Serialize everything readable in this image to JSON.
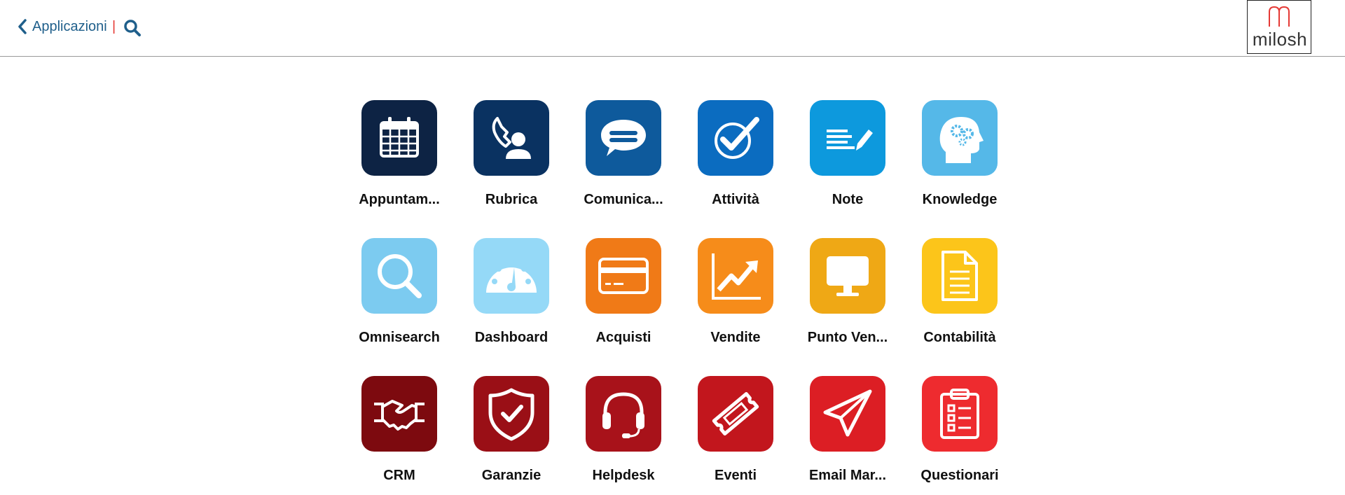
{
  "header": {
    "back_label": "Applicazioni",
    "separator": "|",
    "logo_text": "milosh"
  },
  "colors": {
    "primary": "#1f5f8b",
    "accent": "#e53935"
  },
  "apps": [
    {
      "label": "Appuntam...",
      "icon": "calendar-icon",
      "color": "#0d2344"
    },
    {
      "label": "Rubrica",
      "icon": "contact-phone-icon",
      "color": "#0a3261"
    },
    {
      "label": "Comunica...",
      "icon": "chat-bubble-icon",
      "color": "#0e5a9c"
    },
    {
      "label": "Attività",
      "icon": "check-circle-icon",
      "color": "#0b6cc0"
    },
    {
      "label": "Note",
      "icon": "note-pencil-icon",
      "color": "#0d99dd"
    },
    {
      "label": "Knowledge",
      "icon": "brain-gears-icon",
      "color": "#55b8e8"
    },
    {
      "label": "Omnisearch",
      "icon": "search-icon",
      "color": "#7ccbf0"
    },
    {
      "label": "Dashboard",
      "icon": "gauge-icon",
      "color": "#95d9f7"
    },
    {
      "label": "Acquisti",
      "icon": "credit-card-icon",
      "color": "#f07a17"
    },
    {
      "label": "Vendite",
      "icon": "trend-chart-icon",
      "color": "#f68c1a"
    },
    {
      "label": "Punto Ven...",
      "icon": "monitor-icon",
      "color": "#efa815"
    },
    {
      "label": "Contabilità",
      "icon": "document-icon",
      "color": "#fcc51a"
    },
    {
      "label": "CRM",
      "icon": "handshake-icon",
      "color": "#7d0a0f"
    },
    {
      "label": "Garanzie",
      "icon": "shield-check-icon",
      "color": "#9a0f16"
    },
    {
      "label": "Helpdesk",
      "icon": "headset-icon",
      "color": "#a8121a"
    },
    {
      "label": "Eventi",
      "icon": "ticket-icon",
      "color": "#c2161d"
    },
    {
      "label": "Email Mar...",
      "icon": "paper-plane-icon",
      "color": "#dc1e24"
    },
    {
      "label": "Questionari",
      "icon": "clipboard-list-icon",
      "color": "#ee2b2f"
    }
  ]
}
